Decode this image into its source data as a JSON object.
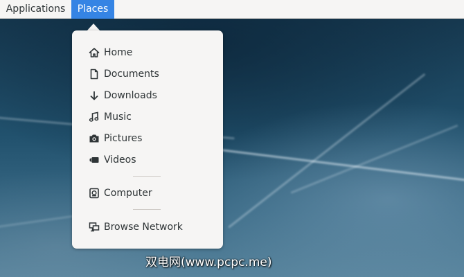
{
  "topbar": {
    "applications_label": "Applications",
    "places_label": "Places"
  },
  "places_menu": {
    "items": [
      {
        "label": "Home",
        "icon": "home-icon"
      },
      {
        "label": "Documents",
        "icon": "document-icon"
      },
      {
        "label": "Downloads",
        "icon": "download-arrow-icon"
      },
      {
        "label": "Music",
        "icon": "music-note-icon"
      },
      {
        "label": "Pictures",
        "icon": "camera-icon"
      },
      {
        "label": "Videos",
        "icon": "video-camera-icon"
      }
    ],
    "computer": {
      "label": "Computer",
      "icon": "computer-icon"
    },
    "network": {
      "label": "Browse Network",
      "icon": "network-icon"
    }
  },
  "colors": {
    "accent": "#3584e4",
    "menu_background": "#f6f5f4",
    "text": "#2e3436"
  },
  "watermark": {
    "text": "双电网(www.pcpc.me)"
  }
}
